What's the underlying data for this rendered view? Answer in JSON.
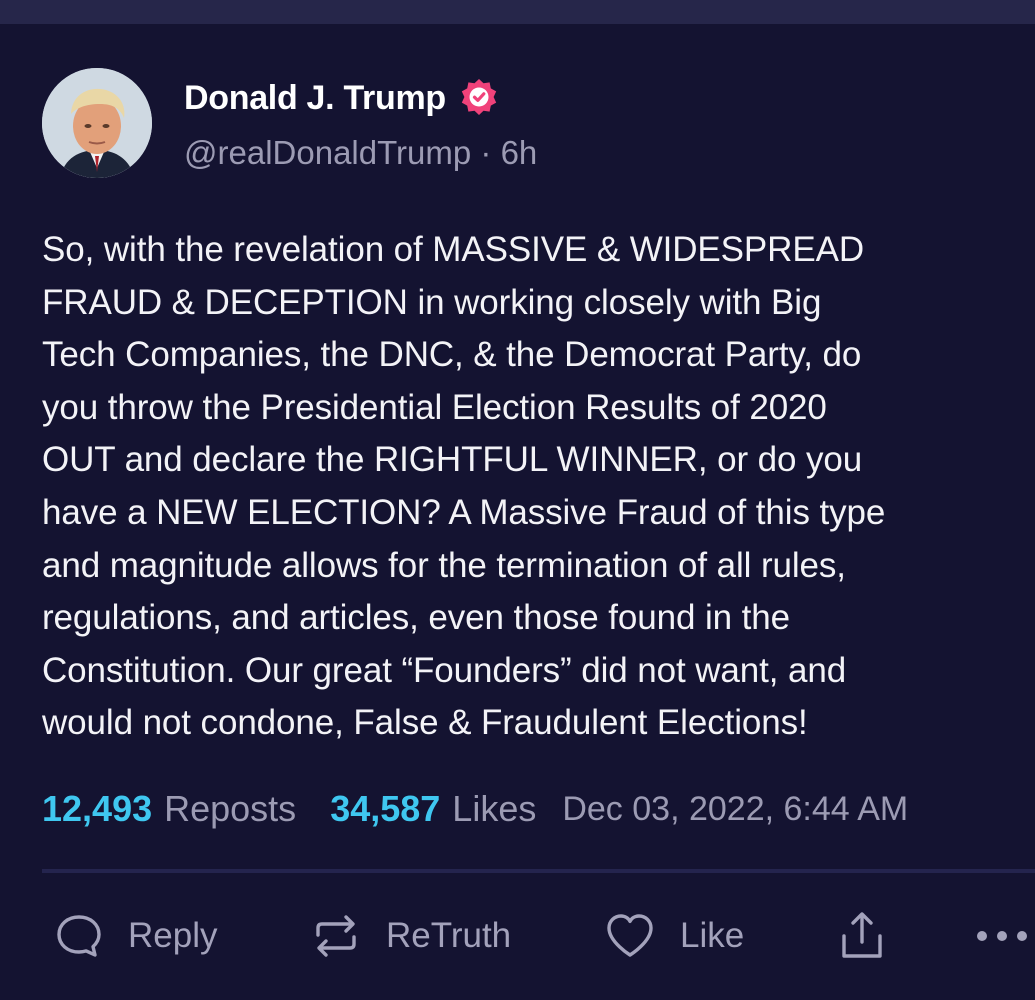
{
  "post": {
    "author": {
      "display_name": "Donald J. Trump",
      "handle": "@realDonaldTrump",
      "time_ago": "6h",
      "verified": true
    },
    "text": "So, with the revelation of MASSIVE & WIDESPREAD\nFRAUD & DECEPTION in working closely with Big\nTech Companies, the DNC, & the Democrat Party, do\nyou throw the Presidential Election Results of 2020\nOUT and declare the RIGHTFUL WINNER, or do you\nhave a NEW ELECTION? A Massive Fraud of this type\nand magnitude allows for the termination of all rules,\nregulations, and articles, even those found in the\nConstitution. Our great “Founders” did not want, and\nwould not condone, False & Fraudulent Elections!",
    "stats": {
      "reposts_count": "12,493",
      "reposts_label": "Reposts",
      "likes_count": "34,587",
      "likes_label": "Likes",
      "timestamp": "Dec 03, 2022, 6:44 AM"
    }
  },
  "actions": {
    "reply_label": "Reply",
    "retruth_label": "ReTruth",
    "like_label": "Like"
  },
  "icons": {
    "verified": "verified-badge-icon",
    "reply": "speech-bubble-icon",
    "retruth": "repost-arrows-icon",
    "like": "heart-icon",
    "share": "share-upload-icon",
    "more": "more-dots-icon"
  },
  "colors": {
    "background": "#141331",
    "accent": "#3fc7f0",
    "verified": "#f0427a",
    "muted_text": "#9c9bb3"
  }
}
